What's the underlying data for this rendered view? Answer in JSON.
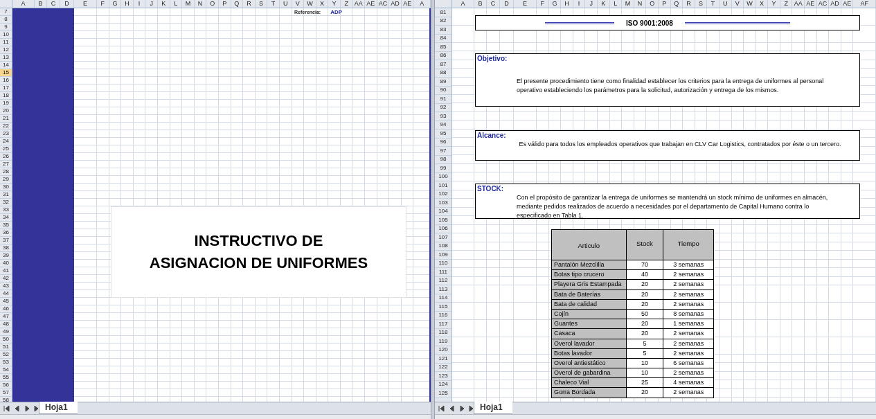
{
  "left_pane": {
    "columns": [
      "A",
      "B",
      "C",
      "D",
      "E",
      "F",
      "G",
      "H",
      "I",
      "J",
      "K",
      "L",
      "M",
      "N",
      "O",
      "P",
      "Q",
      "R",
      "S",
      "T",
      "U",
      "V",
      "W",
      "X",
      "Y",
      "Z",
      "AA",
      "AE",
      "AC",
      "AD",
      "AE",
      "A"
    ],
    "rows": [
      {
        "label": "7",
        "selected": false
      },
      {
        "label": "8",
        "selected": false
      },
      {
        "label": "9",
        "selected": false
      },
      {
        "label": "10",
        "selected": false
      },
      {
        "label": "11",
        "selected": false
      },
      {
        "label": "12",
        "selected": false
      },
      {
        "label": "13",
        "selected": false
      },
      {
        "label": "14",
        "selected": false
      },
      {
        "label": "15",
        "selected": true
      },
      {
        "label": "16",
        "selected": false
      },
      {
        "label": "17",
        "selected": false
      },
      {
        "label": "18",
        "selected": false
      },
      {
        "label": "19",
        "selected": false
      },
      {
        "label": "20",
        "selected": false
      },
      {
        "label": "21",
        "selected": false
      },
      {
        "label": "22",
        "selected": false
      },
      {
        "label": "23",
        "selected": false
      },
      {
        "label": "24",
        "selected": false
      },
      {
        "label": "25",
        "selected": false
      },
      {
        "label": "26",
        "selected": false
      },
      {
        "label": "27",
        "selected": false
      },
      {
        "label": "28",
        "selected": false
      },
      {
        "label": "29",
        "selected": false
      },
      {
        "label": "30",
        "selected": false
      },
      {
        "label": "31",
        "selected": false
      },
      {
        "label": "32",
        "selected": false
      },
      {
        "label": "33",
        "selected": false
      },
      {
        "label": "34",
        "selected": false
      },
      {
        "label": "35",
        "selected": false
      },
      {
        "label": "36",
        "selected": false
      },
      {
        "label": "37",
        "selected": false
      },
      {
        "label": "38",
        "selected": false
      },
      {
        "label": "39",
        "selected": false
      },
      {
        "label": "40",
        "selected": false
      },
      {
        "label": "41",
        "selected": false
      },
      {
        "label": "42",
        "selected": false
      },
      {
        "label": "43",
        "selected": false
      },
      {
        "label": "44",
        "selected": false
      },
      {
        "label": "45",
        "selected": false
      },
      {
        "label": "46",
        "selected": false
      },
      {
        "label": "47",
        "selected": false
      },
      {
        "label": "48",
        "selected": false
      },
      {
        "label": "49",
        "selected": false
      },
      {
        "label": "50",
        "selected": false
      },
      {
        "label": "51",
        "selected": false
      },
      {
        "label": "52",
        "selected": false
      },
      {
        "label": "53",
        "selected": false
      },
      {
        "label": "54",
        "selected": false
      },
      {
        "label": "55",
        "selected": false
      },
      {
        "label": "56",
        "selected": false
      },
      {
        "label": "57",
        "selected": false
      },
      {
        "label": "58",
        "selected": false
      }
    ],
    "reference": {
      "label": "Referencia:",
      "value": "ADP"
    },
    "title_lines": [
      "INSTRUCTIVO DE",
      "ASIGNACION DE UNIFORMES"
    ],
    "sheet_tab": "Hoja1"
  },
  "right_pane": {
    "columns": [
      "A",
      "B",
      "C",
      "D",
      "E",
      "F",
      "G",
      "H",
      "I",
      "J",
      "K",
      "L",
      "M",
      "N",
      "O",
      "P",
      "Q",
      "R",
      "S",
      "T",
      "U",
      "V",
      "W",
      "X",
      "Y",
      "Z",
      "AA",
      "AE",
      "AC",
      "AD",
      "AE",
      "AF"
    ],
    "rows": [
      {
        "label": "81",
        "selected": false
      },
      {
        "label": "82",
        "selected": false
      },
      {
        "label": "83",
        "selected": false
      },
      {
        "label": "84",
        "selected": false
      },
      {
        "label": "85",
        "selected": false
      },
      {
        "label": "86",
        "selected": false
      },
      {
        "label": "87",
        "selected": false
      },
      {
        "label": "88",
        "selected": false
      },
      {
        "label": "89",
        "selected": false
      },
      {
        "label": "90",
        "selected": false
      },
      {
        "label": "91",
        "selected": false
      },
      {
        "label": "92",
        "selected": false
      },
      {
        "label": "93",
        "selected": false
      },
      {
        "label": "94",
        "selected": false
      },
      {
        "label": "95",
        "selected": false
      },
      {
        "label": "96",
        "selected": false
      },
      {
        "label": "97",
        "selected": false
      },
      {
        "label": "98",
        "selected": false
      },
      {
        "label": "99",
        "selected": false
      },
      {
        "label": "100",
        "selected": false
      },
      {
        "label": "101",
        "selected": false
      },
      {
        "label": "102",
        "selected": false
      },
      {
        "label": "103",
        "selected": false
      },
      {
        "label": "104",
        "selected": false
      },
      {
        "label": "105",
        "selected": false
      },
      {
        "label": "106",
        "selected": false
      },
      {
        "label": "107",
        "selected": false
      },
      {
        "label": "108",
        "selected": false
      },
      {
        "label": "109",
        "selected": false
      },
      {
        "label": "110",
        "selected": false
      },
      {
        "label": "111",
        "selected": false
      },
      {
        "label": "112",
        "selected": false
      },
      {
        "label": "113",
        "selected": false
      },
      {
        "label": "114",
        "selected": false
      },
      {
        "label": "115",
        "selected": false
      },
      {
        "label": "116",
        "selected": false
      },
      {
        "label": "117",
        "selected": false
      },
      {
        "label": "118",
        "selected": false
      },
      {
        "label": "119",
        "selected": false
      },
      {
        "label": "120",
        "selected": false
      },
      {
        "label": "121",
        "selected": false
      },
      {
        "label": "122",
        "selected": false
      },
      {
        "label": "123",
        "selected": false
      },
      {
        "label": "124",
        "selected": false
      },
      {
        "label": "125",
        "selected": false
      }
    ],
    "header_box": {
      "title": "ISO 9001:2008"
    },
    "sections": [
      {
        "label": "Objetivo:",
        "text": "El presente procedimiento tiene como finalidad establecer los criterios para la entrega de uniformes al personal operativo estableciendo los parámetros para la solicitud, autorización y entrega de los mismos."
      },
      {
        "label": "Alcance:",
        "text": "Es válido para todos los empleados operativos que trabajan en CLV Car Logistics, contratados por éste o un tercero."
      },
      {
        "label": "STOCK:",
        "text": "Con el propósito de garantizar la entrega de uniformes se mantendrá un stock mínimo de uniformes en almacén, mediante pedidos  realizados de acuerdo a necesidades por el departamento de Capital Humano contra lo especificado en Tabla 1."
      }
    ],
    "table": {
      "columns": [
        "Articulo",
        "Stock",
        "Tiempo"
      ],
      "rows": [
        [
          "Pantalón Mezclilla",
          "70",
          "3 semanas"
        ],
        [
          "Botas tipo crucero",
          "40",
          "2 semanas"
        ],
        [
          "Playera Gris Estampada",
          "20",
          "2 semanas"
        ],
        [
          "Bata de Baterías",
          "20",
          "2 semanas"
        ],
        [
          "Bata de calidad",
          "20",
          "2 semanas"
        ],
        [
          "Cojín",
          "50",
          "8 semanas"
        ],
        [
          "Guantes",
          "20",
          "1 semanas"
        ],
        [
          "Casaca",
          "20",
          "2 semanas"
        ],
        [
          "Overol lavador",
          "5",
          "2 semanas"
        ],
        [
          "Botas lavador",
          "5",
          "2 semanas"
        ],
        [
          "Overol antiestático",
          "10",
          "6 semanas"
        ],
        [
          "Overol de gabardina",
          "10",
          "2 semanas"
        ],
        [
          "Chaleco Vial",
          "25",
          "4 semanas"
        ],
        [
          "Gorra Bordada",
          "20",
          "2 semanas"
        ]
      ]
    },
    "sheet_tab": "Hoja1"
  }
}
